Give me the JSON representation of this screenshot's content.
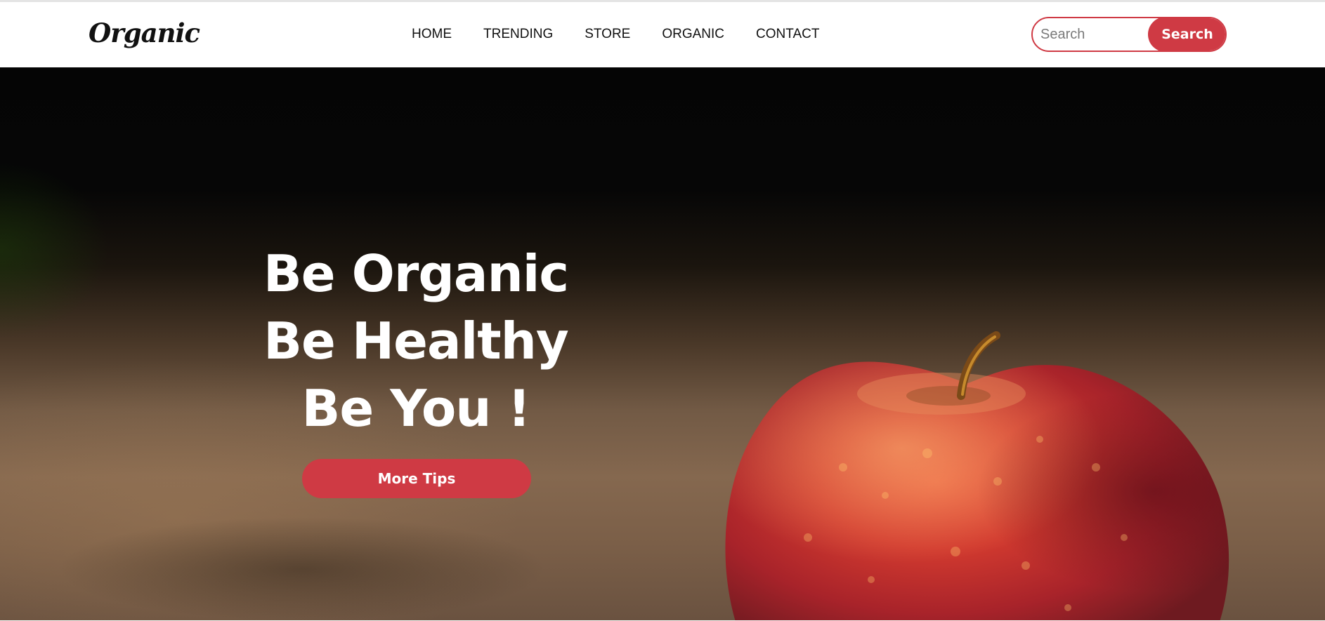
{
  "navbar": {
    "logo": "Organic",
    "links": [
      "HOME",
      "TRENDING",
      "STORE",
      "ORGANIC",
      "CONTACT"
    ],
    "search": {
      "placeholder": "Search",
      "button_label": "Search"
    }
  },
  "hero": {
    "headline": [
      "Be Organic",
      "Be Healthy",
      "Be You !"
    ],
    "cta_label": "More Tips",
    "image": "red-apple-photo"
  },
  "colors": {
    "accent": "#cf3a44",
    "text_dark": "#111111",
    "hero_text": "#ffffff"
  }
}
